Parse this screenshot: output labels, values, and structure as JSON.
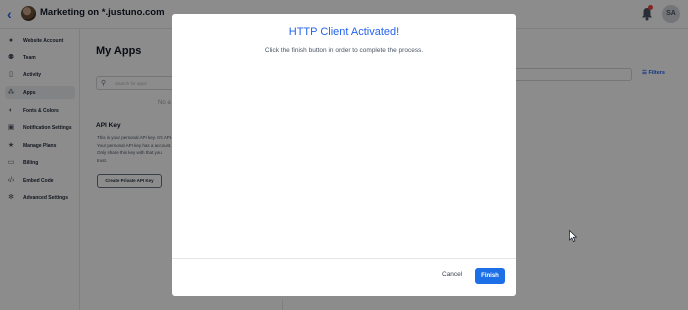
{
  "header": {
    "title": "Marketing on *.justuno.com",
    "user_initials": "SA"
  },
  "sidebar": {
    "items": [
      {
        "label": "Website Account",
        "icon": "account-circle-icon"
      },
      {
        "label": "Team",
        "icon": "team-icon"
      },
      {
        "label": "Activity",
        "icon": "activity-icon"
      },
      {
        "label": "Apps",
        "icon": "apps-icon",
        "active": true
      },
      {
        "label": "Fonts & Colors",
        "icon": "palette-icon"
      },
      {
        "label": "Notification Settings",
        "icon": "notification-icon"
      },
      {
        "label": "Manage Plans",
        "icon": "star-icon"
      },
      {
        "label": "Billing",
        "icon": "credit-card-icon"
      },
      {
        "label": "Embed Code",
        "icon": "code-icon"
      },
      {
        "label": "Advanced Settings",
        "icon": "gear-icon"
      }
    ]
  },
  "main": {
    "title": "My Apps",
    "search_placeholder": "Search for apps",
    "empty_text": "No a",
    "api_key_title": "API Key",
    "api_key_description": "This is your personal API key. It's API. Your personal API key has a account. Only share this key with that you trust.",
    "api_key_button": "Create Private API Key",
    "filters_label": "Filters"
  },
  "modal": {
    "title": "HTTP Client Activated!",
    "subtitle": "Click the finish button in order to complete the process.",
    "cancel_label": "Cancel",
    "finish_label": "Finish"
  },
  "colors": {
    "accent": "#1d6fe8",
    "overlay": "rgba(0,0,0,0.45)"
  }
}
